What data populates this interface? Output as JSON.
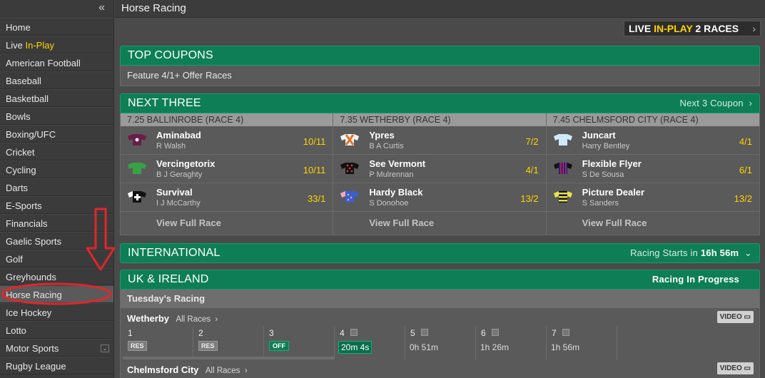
{
  "sidebar": {
    "collapse_glyph": "«",
    "items": [
      {
        "label": "Home"
      },
      {
        "label": "Live",
        "label_accent": "In-Play"
      },
      {
        "label": "American Football"
      },
      {
        "label": "Baseball"
      },
      {
        "label": "Basketball"
      },
      {
        "label": "Bowls"
      },
      {
        "label": "Boxing/UFC"
      },
      {
        "label": "Cricket"
      },
      {
        "label": "Cycling"
      },
      {
        "label": "Darts"
      },
      {
        "label": "E-Sports"
      },
      {
        "label": "Financials"
      },
      {
        "label": "Gaelic Sports"
      },
      {
        "label": "Golf"
      },
      {
        "label": "Greyhounds"
      },
      {
        "label": "Horse Racing"
      },
      {
        "label": "Ice Hockey"
      },
      {
        "label": "Lotto"
      },
      {
        "label": "Motor Sports"
      },
      {
        "label": "Rugby League"
      }
    ],
    "more_glyph": "⌄"
  },
  "header": {
    "title": "Horse Racing"
  },
  "live_bar": {
    "live": "LIVE",
    "in_play": "IN-PLAY",
    "count": "2 RACES",
    "chevron": "›"
  },
  "top_coupons": {
    "title": "TOP COUPONS",
    "item": "Feature 4/1+ Offer Races"
  },
  "next_three": {
    "title": "NEXT THREE",
    "link": "Next 3 Coupon",
    "link_chevron": "›",
    "view_full_label": "View Full Race",
    "races": [
      {
        "title": "7.25 BALLINROBE (RACE 4)",
        "runners": [
          {
            "name": "Aminabad",
            "jockey": "R Walsh",
            "odds": "10/11",
            "silk_icon": "maroon-star-silk"
          },
          {
            "name": "Vercingetorix",
            "jockey": "B J Geraghty",
            "odds": "10/11",
            "silk_icon": "green-silk"
          },
          {
            "name": "Survival",
            "jockey": "I J McCarthy",
            "odds": "33/1",
            "silk_icon": "black-cross-silk"
          }
        ]
      },
      {
        "title": "7.35 WETHERBY (RACE 4)",
        "runners": [
          {
            "name": "Ypres",
            "jockey": "B A Curtis",
            "odds": "7/2",
            "silk_icon": "white-orange-cross-silk"
          },
          {
            "name": "See Vermont",
            "jockey": "P Mulrennan",
            "odds": "4/1",
            "silk_icon": "black-red-spots-silk"
          },
          {
            "name": "Hardy Black",
            "jockey": "S Donohoe",
            "odds": "13/2",
            "silk_icon": "pink-blue-silk"
          }
        ]
      },
      {
        "title": "7.45 CHELMSFORD CITY (RACE 4)",
        "runners": [
          {
            "name": "Juncart",
            "jockey": "Harry Bentley",
            "odds": "4/1",
            "silk_icon": "light-blue-silk"
          },
          {
            "name": "Flexible Flyer",
            "jockey": "S De Sousa",
            "odds": "6/1",
            "silk_icon": "purple-stripes-silk"
          },
          {
            "name": "Picture Dealer",
            "jockey": "S Sanders",
            "odds": "13/2",
            "silk_icon": "yellow-black-hoops-silk"
          }
        ]
      }
    ]
  },
  "international": {
    "title": "INTERNATIONAL",
    "starts_label": "Racing Starts in",
    "starts_time": "16h 56m",
    "chevron": "⌄"
  },
  "uk_ireland": {
    "title": "UK & IRELAND",
    "status": "Racing In Progress",
    "day_label": "Tuesday's Racing",
    "meetings": [
      {
        "name": "Wetherby",
        "all_races": "All Races",
        "chevron": "›",
        "video": "VIDEO",
        "races": [
          {
            "num": "1",
            "badge": "RES"
          },
          {
            "num": "2",
            "badge": "RES"
          },
          {
            "num": "3",
            "badge": "OFF"
          },
          {
            "num": "4",
            "time": "20m 4s"
          },
          {
            "num": "5",
            "time": "0h 51m"
          },
          {
            "num": "6",
            "time": "1h 26m"
          },
          {
            "num": "7",
            "time": "1h 56m"
          }
        ]
      },
      {
        "name": "Chelmsford City",
        "all_races": "All Races",
        "chevron": "›",
        "video": "VIDEO"
      }
    ]
  },
  "colors": {
    "accent_green": "#0e7e57",
    "odds_yellow": "#ffd400",
    "annotation_red": "#e0262b"
  }
}
